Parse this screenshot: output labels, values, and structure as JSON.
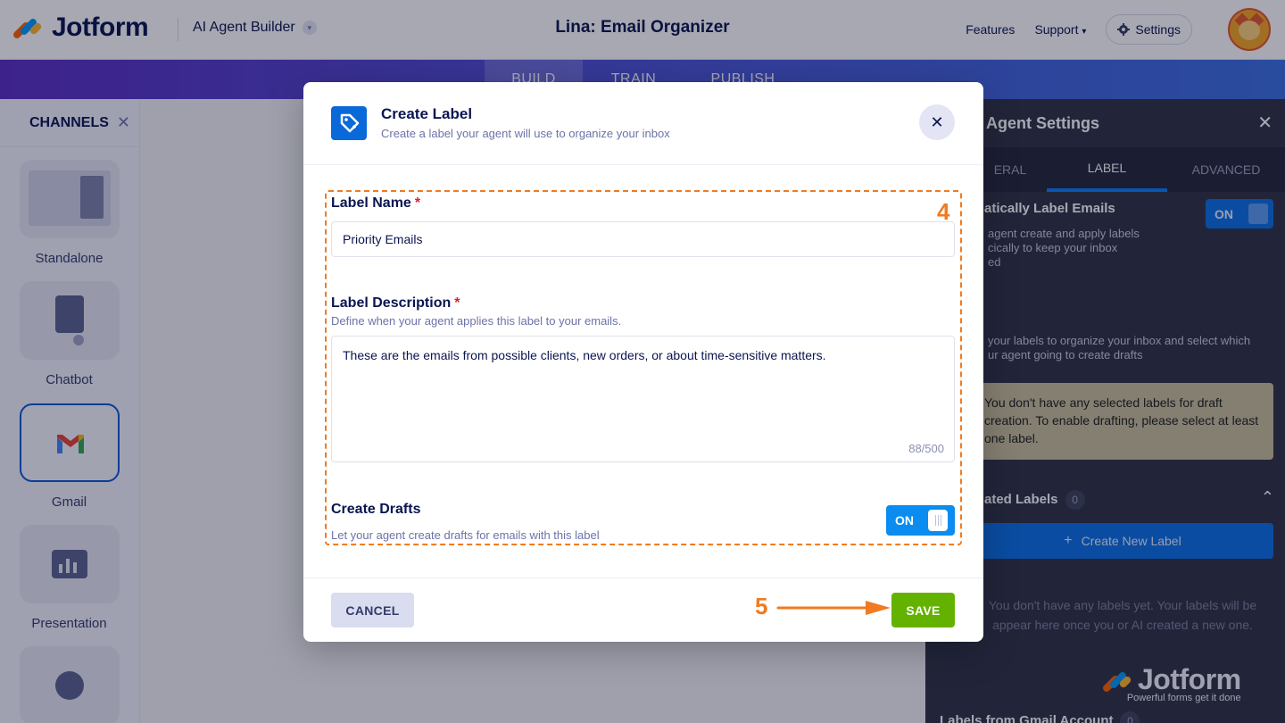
{
  "header": {
    "brand": "Jotform",
    "product": "AI Agent Builder",
    "title": "Lina: Email Organizer",
    "nav": {
      "features": "Features",
      "support": "Support",
      "settings": "Settings"
    }
  },
  "build_tabs": [
    "BUILD",
    "TRAIN",
    "PUBLISH"
  ],
  "channels": {
    "title": "CHANNELS",
    "items": [
      {
        "label": "Standalone"
      },
      {
        "label": "Chatbot"
      },
      {
        "label": "Gmail"
      },
      {
        "label": "Presentation"
      }
    ]
  },
  "agent_settings": {
    "title": "Agent Settings",
    "tabs": [
      "ERAL",
      "LABEL",
      "ADVANCED"
    ],
    "auto_label_title": "atically Label Emails",
    "auto_label_toggle": "ON",
    "auto_label_desc_1": "agent create and apply labels",
    "auto_label_desc_2": "cically to keep your inbox",
    "auto_label_desc_3": "ed",
    "select_desc_1": "your labels to organize your inbox and select which",
    "select_desc_2": "ur agent going to create drafts",
    "warning": "You don't have any selected labels for draft creation. To enable drafting, please select at least one label.",
    "created_labels_title": "ated Labels",
    "created_labels_count": "0",
    "create_button": "Create New Label",
    "empty_text": "You don't have any labels yet. Your labels will be appear here once you or AI created a new one.",
    "gmail_labels_title": "Labels from Gmail Account",
    "gmail_labels_count": "0"
  },
  "watermark": {
    "name": "Jotform",
    "tagline": "Powerful forms get it done"
  },
  "modal": {
    "title": "Create Label",
    "subtitle": "Create a label your agent will use to organize your inbox",
    "label_name": {
      "label": "Label Name",
      "required": "*",
      "value": "Priority Emails"
    },
    "label_description": {
      "label": "Label Description",
      "required": "*",
      "help": "Define when your agent applies this label to your emails.",
      "value": "These are the emails from possible clients, new orders, or about time-sensitive matters.",
      "counter": "88/500"
    },
    "create_drafts": {
      "label": "Create Drafts",
      "help": "Let your agent create drafts for emails with this label",
      "toggle": "ON"
    },
    "cancel": "CANCEL",
    "save": "SAVE"
  },
  "annotations": {
    "step_4": "4",
    "step_5": "5"
  },
  "colors": {
    "accent": "#0a8cf0",
    "save": "#64b200",
    "annotation": "#f07b21",
    "navy": "#0a1551"
  }
}
